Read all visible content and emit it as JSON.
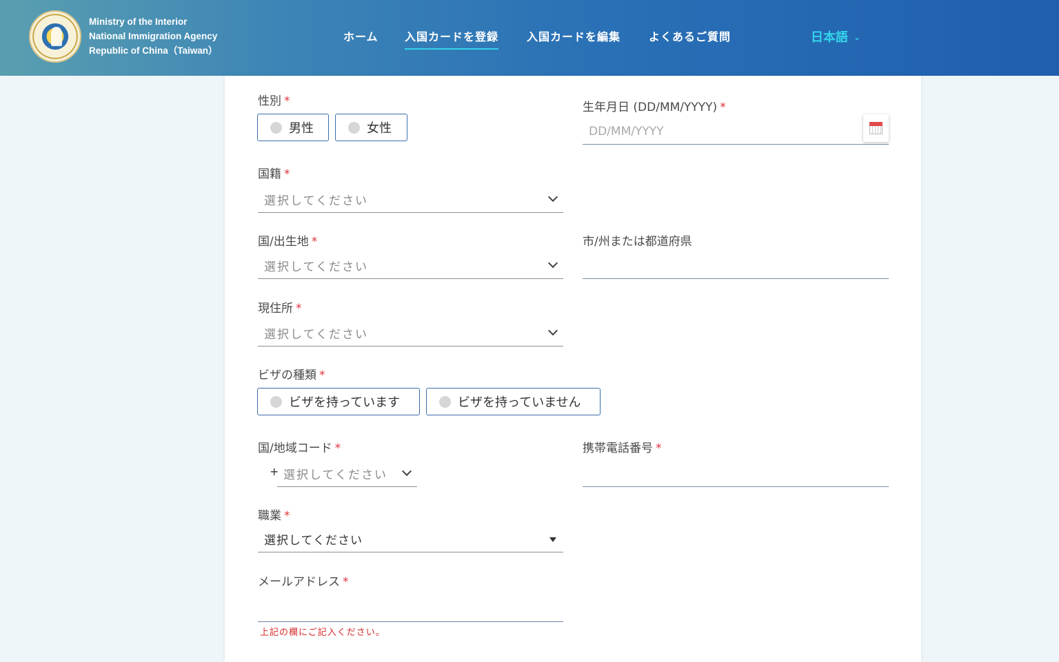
{
  "header": {
    "agency_line1": "Ministry of the Interior",
    "agency_line2": "National Immigration Agency",
    "agency_line3": "Republic of China（Taiwan）",
    "logo_text": "National Immigration Agency",
    "nav": {
      "home": "ホーム",
      "register": "入国カードを登録",
      "edit": "入国カードを編集",
      "faq": "よくあるご質問"
    },
    "language": "日本語"
  },
  "form": {
    "gender": {
      "label": "性別",
      "options": [
        "男性",
        "女性"
      ]
    },
    "dob": {
      "label": "生年月日 (DD/MM/YYYY)",
      "placeholder": "DD/MM/YYYY"
    },
    "nationality": {
      "label": "国籍",
      "placeholder": "選択してください"
    },
    "birthplace": {
      "label": "国/出生地",
      "placeholder": "選択してください"
    },
    "city": {
      "label": "市/州または都道府県",
      "value": ""
    },
    "residence": {
      "label": "現住所",
      "placeholder": "選択してください"
    },
    "visa": {
      "label": "ビザの種類",
      "options": [
        "ビザを持っています",
        "ビザを持っていません"
      ]
    },
    "country_code": {
      "label": "国/地域コード",
      "prefix": "+",
      "placeholder": "選択してください"
    },
    "mobile": {
      "label": "携帯電話番号",
      "value": ""
    },
    "occupation": {
      "label": "職業",
      "selected": "選択してください"
    },
    "email": {
      "label": "メールアドレス",
      "value": "",
      "error": "上記の欄にご記入ください。"
    },
    "required_mark": "*"
  },
  "colors": {
    "accent": "#34d3ea",
    "required": "#e0333c",
    "button_border": "#3a6da8"
  }
}
